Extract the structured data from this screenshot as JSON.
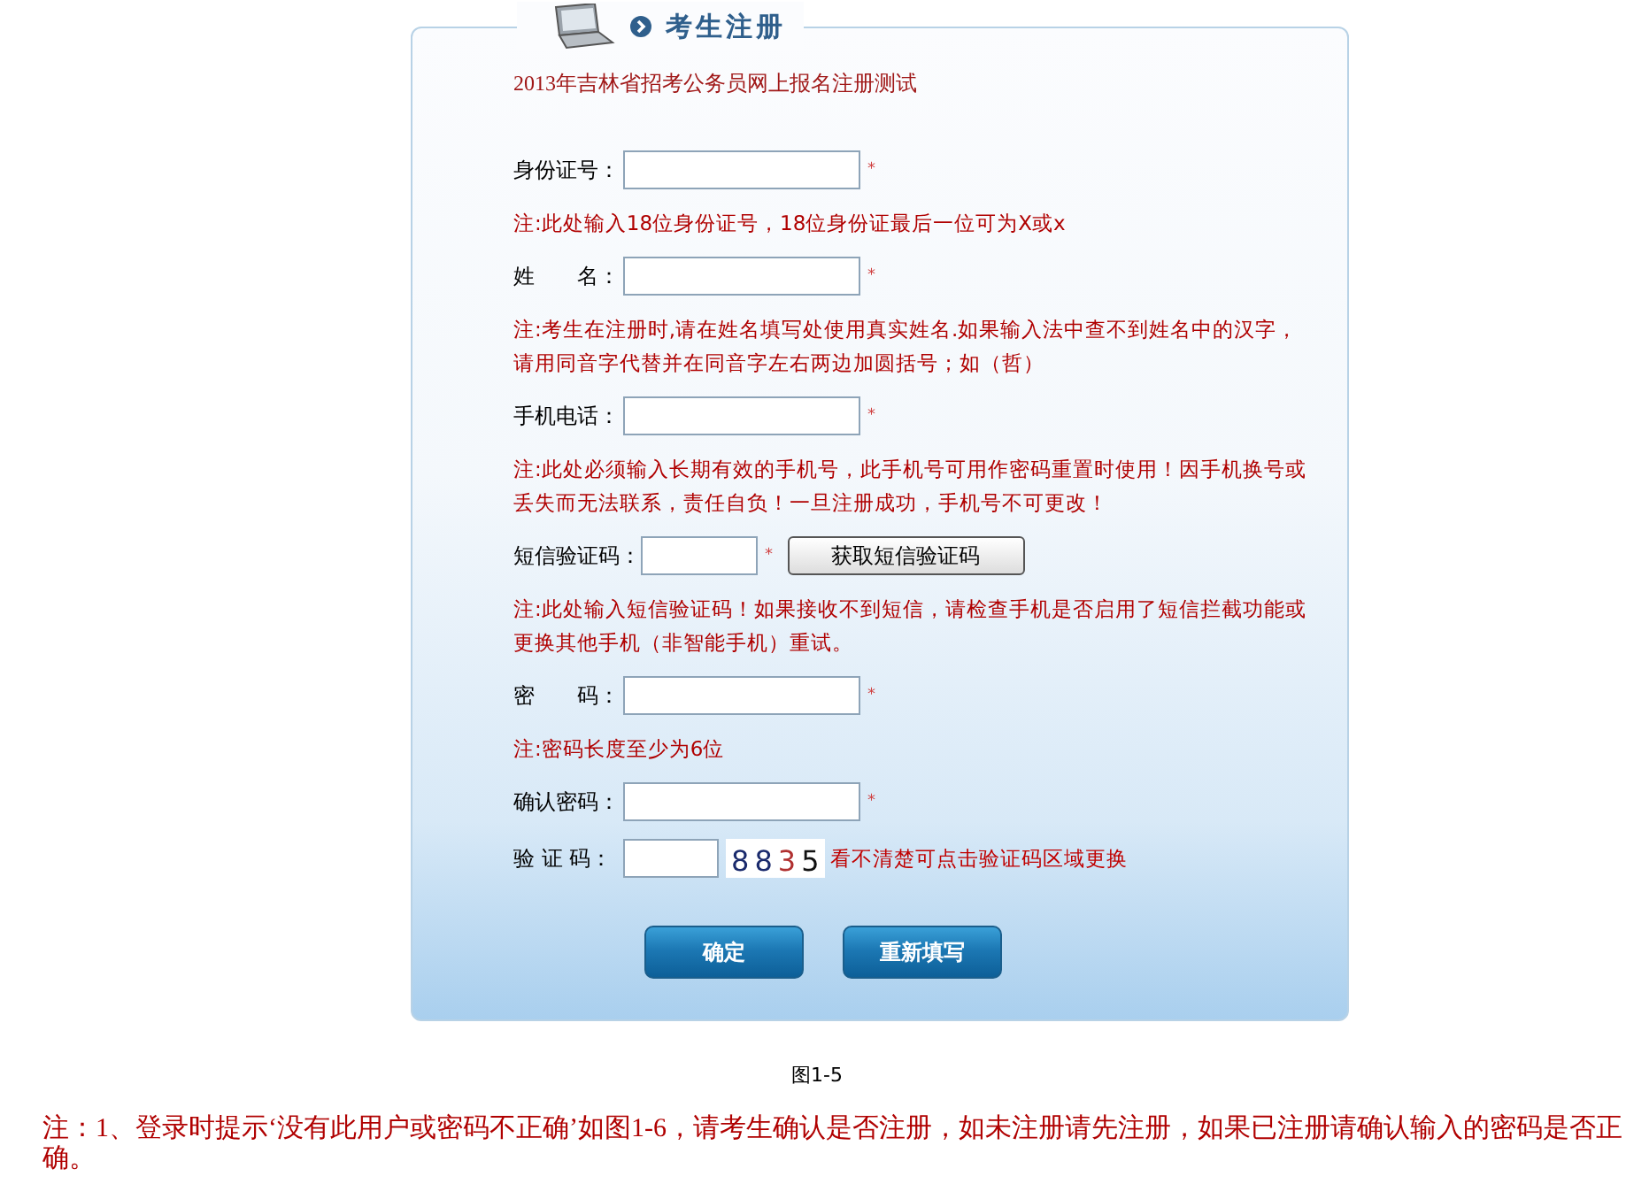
{
  "panel": {
    "title": "考生注册",
    "subtitle": "2013年吉林省招考公务员网上报名注册测试"
  },
  "fields": [
    {
      "kind": "text",
      "label": "身份证号：",
      "mark": "*",
      "note": "注:此处输入18位身份证号，18位身份证最后一位可为X或x"
    },
    {
      "kind": "text",
      "label": "姓　　名：",
      "mark": "*",
      "note": "注:考生在注册时,请在姓名填写处使用真实姓名.如果输入法中查不到姓名中的汉字，请用同音字代替并在同音字左右两边加圆括号；如（哲）"
    },
    {
      "kind": "text",
      "label": "手机电话：",
      "mark": "*",
      "note": "注:此处必须输入长期有效的手机号，此手机号可用作密码重置时使用！因手机换号或丢失而无法联系，责任自负！一旦注册成功，手机号不可更改！"
    },
    {
      "kind": "sms",
      "label": "短信验证码：",
      "mark": "*",
      "button": "获取短信验证码",
      "note": "注:此处输入短信验证码！如果接收不到短信，请检查手机是否启用了短信拦截功能或更换其他手机（非智能手机）重试。"
    },
    {
      "kind": "text",
      "label": "密　　码：",
      "mark": "*",
      "note": "注:密码长度至少为6位"
    },
    {
      "kind": "text",
      "label": "确认密码：",
      "mark": "*"
    },
    {
      "kind": "captcha",
      "label": "验 证 码：",
      "digits": [
        {
          "text": "8",
          "color": "#1a2a6c"
        },
        {
          "text": "8",
          "color": "#1a2a6c"
        },
        {
          "text": "3",
          "color": "#b03030"
        },
        {
          "text": "5",
          "color": "#111111"
        }
      ],
      "hint": "看不清楚可点击验证码区域更换"
    }
  ],
  "buttons": [
    "确定",
    "重新填写"
  ],
  "caption": "图1-5",
  "footnote": "注：1、登录时提示‘没有此用户或密码不正确’如图1-6，请考生确认是否注册，如未注册请先注册，如果已注册请确认输入的密码是否正确。"
}
